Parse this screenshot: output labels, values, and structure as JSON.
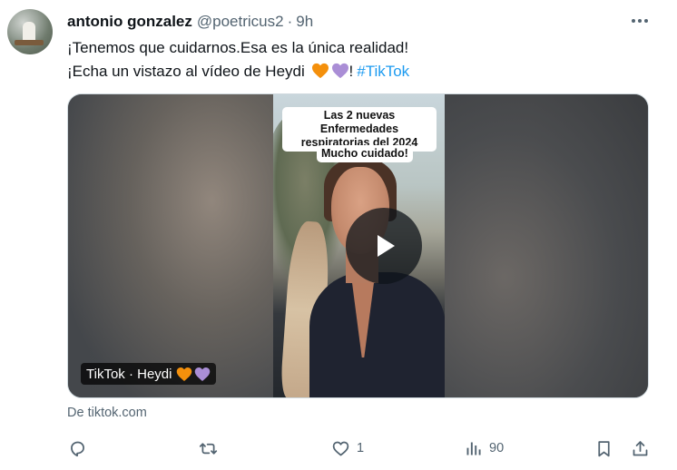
{
  "tweet": {
    "author_name": "antonio gonzalez",
    "handle": "@poetricus2",
    "separator": "·",
    "time": "9h",
    "text_line1": "¡Tenemos que cuidarnos.Esa es la única realidad!",
    "text_line2_prefix": "¡Echa un vistazo al vídeo de Heydi",
    "text_line2_suffix": "!",
    "hashtag": "#TikTok"
  },
  "card": {
    "caption_line1": "Las 2 nuevas Enfermedades",
    "caption_line2": "respiratorias del 2024",
    "caption_line3": "Mucho cuidado!",
    "label": "TikTok · Heydi",
    "source": "De tiktok.com"
  },
  "actions": {
    "reply_count": "",
    "retweet_count": "",
    "like_count": "1",
    "views_count": "90"
  },
  "colors": {
    "accent": "#1d9bf0",
    "secondary_text": "#536471",
    "heart_orange": "#f4900c",
    "heart_purple": "#aa8ed6"
  },
  "icons": [
    "more-icon",
    "play-icon",
    "reply-icon",
    "retweet-icon",
    "like-icon",
    "views-icon",
    "bookmark-icon",
    "share-icon",
    "orange-heart-icon",
    "purple-heart-icon"
  ]
}
